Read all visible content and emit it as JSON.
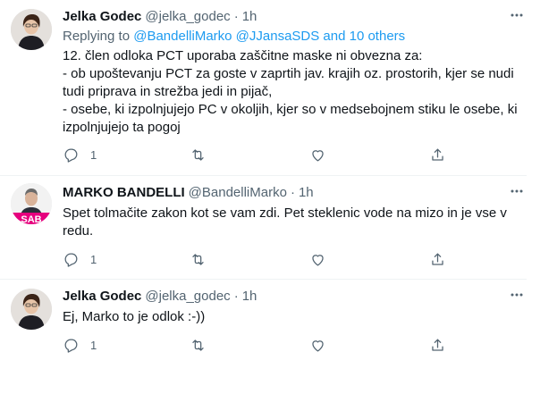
{
  "tweets": [
    {
      "name": "Jelka Godec",
      "handle": "@jelka_godec",
      "dot": "·",
      "time": "1h",
      "replying_prefix": "Replying to",
      "replying_links": "@BandelliMarko @JJansaSDS and 10 others",
      "text": "12. člen odloka PCT uporaba zaščitne maske ni obvezna za:\n- ob upoštevanju PCT za goste v zaprtih jav. krajih oz. prostorih, kjer se nudi tudi priprava in strežba jedi in pijač,\n- osebe, ki izpolnjujejo PC v okoljih, kjer so v medsebojnem stiku le osebe, ki izpolnjujejo ta pogoj",
      "reply_count": "1",
      "retweet_count": "",
      "like_count": ""
    },
    {
      "name": "MARKO BANDELLI",
      "handle": "@BandelliMarko",
      "dot": "·",
      "time": "1h",
      "avatar_text": "SAB",
      "text": "Spet tolmačite zakon kot se vam zdi. Pet steklenic vode na mizo in je vse v redu.",
      "reply_count": "1",
      "retweet_count": "",
      "like_count": ""
    },
    {
      "name": "Jelka Godec",
      "handle": "@jelka_godec",
      "dot": "·",
      "time": "1h",
      "text": "Ej, Marko to je odlok :-))",
      "reply_count": "1",
      "retweet_count": "",
      "like_count": ""
    }
  ],
  "colors": {
    "text": "#0f1419",
    "secondary": "#536471",
    "link": "#1d9bf0",
    "divider": "#eff3f4",
    "sab_pink": "#e6007e"
  },
  "icons": [
    "more-icon",
    "reply-icon",
    "retweet-icon",
    "like-icon",
    "share-icon"
  ]
}
